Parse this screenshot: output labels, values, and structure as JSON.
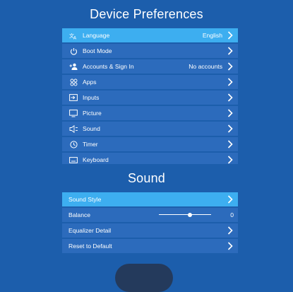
{
  "device_prefs": {
    "title": "Device Preferences",
    "items": [
      {
        "label": "Language",
        "value": "English",
        "icon": "translate-icon",
        "selected": true
      },
      {
        "label": "Boot Mode",
        "value": "",
        "icon": "power-icon",
        "selected": false
      },
      {
        "label": "Accounts & Sign In",
        "value": "No accounts",
        "icon": "account-add-icon",
        "selected": false
      },
      {
        "label": "Apps",
        "value": "",
        "icon": "apps-grid-icon",
        "selected": false
      },
      {
        "label": "Inputs",
        "value": "",
        "icon": "input-icon",
        "selected": false
      },
      {
        "label": "Picture",
        "value": "",
        "icon": "monitor-icon",
        "selected": false
      },
      {
        "label": "Sound",
        "value": "",
        "icon": "speaker-icon",
        "selected": false
      },
      {
        "label": "Timer",
        "value": "",
        "icon": "clock-icon",
        "selected": false
      },
      {
        "label": "Keyboard",
        "value": "",
        "icon": "keyboard-icon",
        "selected": false
      }
    ]
  },
  "sound": {
    "title": "Sound",
    "items": [
      {
        "label": "Sound Style",
        "value": "",
        "selected": true
      },
      {
        "label": "Balance",
        "value": "0",
        "slider_fraction": 0.6,
        "selected": false
      },
      {
        "label": "Equalizer Detail",
        "value": "",
        "selected": false
      },
      {
        "label": "Reset to Default",
        "value": "",
        "selected": false
      }
    ]
  },
  "colors": {
    "background": "#1c5eac",
    "row": "#2c6bbc",
    "selected_row": "#3daef0"
  }
}
